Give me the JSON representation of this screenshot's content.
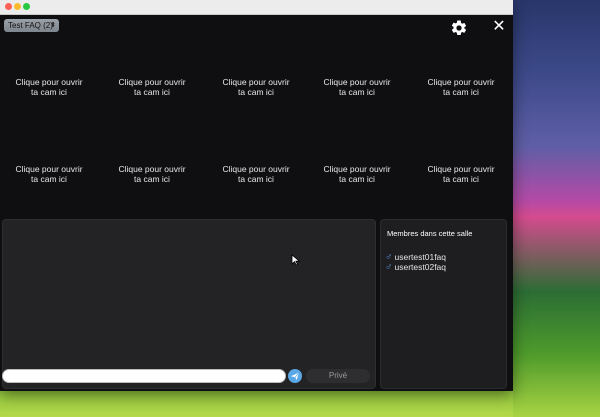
{
  "header": {
    "room_select_value": "Test FAQ (2)",
    "close_glyph": "✕",
    "settings_icon": "gear-icon"
  },
  "cams": [
    {
      "line1": "Clique pour ouvrir",
      "line2": "ta cam ici"
    },
    {
      "line1": "Clique pour ouvrir",
      "line2": "ta cam ici"
    },
    {
      "line1": "Clique pour ouvrir",
      "line2": "ta cam ici"
    },
    {
      "line1": "Clique pour ouvrir",
      "line2": "ta cam ici"
    },
    {
      "line1": "Clique pour ouvrir",
      "line2": "ta cam ici"
    },
    {
      "line1": "Clique pour ouvrir",
      "line2": "ta cam ici"
    },
    {
      "line1": "Clique pour ouvrir",
      "line2": "ta cam ici"
    },
    {
      "line1": "Clique pour ouvrir",
      "line2": "ta cam ici"
    },
    {
      "line1": "Clique pour ouvrir",
      "line2": "ta cam ici"
    },
    {
      "line1": "Clique pour ouvrir",
      "line2": "ta cam ici"
    }
  ],
  "chat": {
    "input_value": "",
    "send_icon": "send-icon",
    "private_label": "Privé"
  },
  "members": {
    "title": "Membres dans cette salle",
    "list": [
      {
        "gender_icon": "♂",
        "name": "usertest01faq"
      },
      {
        "gender_icon": "♂",
        "name": "usertest02faq"
      }
    ]
  },
  "colors": {
    "window_bg": "#0f0f11",
    "panel_bg": "#232325",
    "accent_send": "#5aa7e6",
    "gender_male": "#5b8ed6"
  }
}
